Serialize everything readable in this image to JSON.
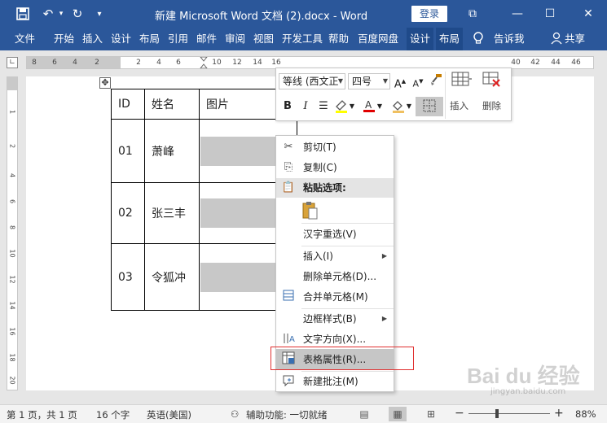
{
  "titlebar": {
    "title": "新建 Microsoft Word 文档 (2).docx  -  Word",
    "login": "登录",
    "save_icon": "save-icon",
    "undo_icon": "undo-icon",
    "redo_icon": "redo-icon",
    "minimize": "—",
    "restore": "☐",
    "close": "✕",
    "ribbon_display": "⧉"
  },
  "tabs": [
    "文件",
    "开始",
    "插入",
    "设计",
    "布局",
    "引用",
    "邮件",
    "审阅",
    "视图",
    "开发工具",
    "帮助",
    "百度网盘",
    "设计",
    "布局"
  ],
  "tell_me": "告诉我",
  "share": "共享",
  "ruler": {
    "numbers": [
      "8",
      "6",
      "4",
      "2",
      "2",
      "4",
      "6",
      "10",
      "12",
      "14",
      "16",
      "18",
      "20",
      "22",
      "24",
      "26",
      "28",
      "30",
      "32",
      "34",
      "36",
      "38",
      "40",
      "42",
      "44",
      "46"
    ]
  },
  "vruler": {
    "numbers": [
      "1",
      "2",
      "4",
      "6",
      "8",
      "10",
      "12",
      "14",
      "16",
      "18",
      "20"
    ]
  },
  "table": {
    "headers": [
      "ID",
      "姓名",
      "图片"
    ],
    "rows": [
      {
        "id": "01",
        "name": "萧峰"
      },
      {
        "id": "02",
        "name": "张三丰"
      },
      {
        "id": "03",
        "name": "令狐冲"
      }
    ]
  },
  "minitoolbar": {
    "font": "等线 (西文正",
    "size": "四号",
    "bold": "B",
    "italic": "I",
    "insert": "插入",
    "delete": "删除"
  },
  "contextmenu": {
    "items": [
      {
        "label": "剪切(T)"
      },
      {
        "label": "复制(C)"
      },
      {
        "label": "粘贴选项:"
      },
      {
        "label": "汉字重选(V)"
      },
      {
        "label": "插入(I)"
      },
      {
        "label": "删除单元格(D)..."
      },
      {
        "label": "合并单元格(M)"
      },
      {
        "label": "边框样式(B)"
      },
      {
        "label": "文字方向(X)..."
      },
      {
        "label": "表格属性(R)..."
      },
      {
        "label": "新建批注(M)"
      }
    ]
  },
  "statusbar": {
    "page": "第 1 页，共 1 页",
    "words": "16 个字",
    "language": "英语(美国)",
    "accessibility": "辅助功能: 一切就绪",
    "zoom": "88%",
    "zoom_minus": "−",
    "zoom_plus": "+"
  },
  "watermark": {
    "text": "Bai du 经验",
    "sub": "jingyan.baidu.com"
  },
  "colors": {
    "brand": "#2b579a",
    "highlight_border": "#e03030",
    "menu_highlight": "#c6c6c6"
  }
}
